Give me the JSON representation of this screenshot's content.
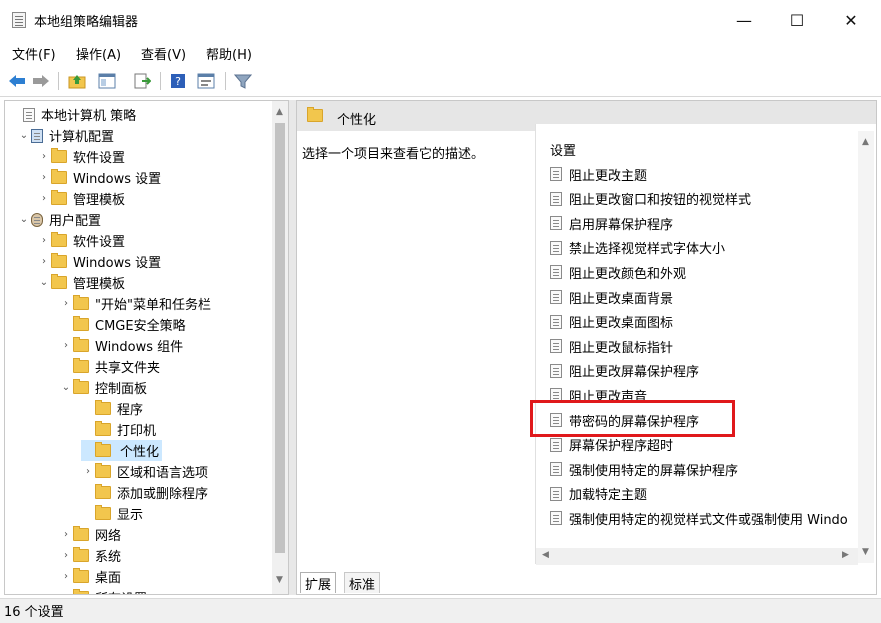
{
  "window": {
    "title": "本地组策略编辑器",
    "minimize": "—",
    "maximize": "☐",
    "close": "✕"
  },
  "menu": [
    "文件(F)",
    "操作(A)",
    "查看(V)",
    "帮助(H)"
  ],
  "toolbar": {
    "back": "back-arrow-icon",
    "forward": "forward-arrow-icon",
    "up": "up-folder-icon",
    "show_hide": "show-hide-tree-icon",
    "export": "export-list-icon",
    "help": "help-icon",
    "properties": "properties-icon",
    "filter": "filter-icon"
  },
  "tree": [
    {
      "label": "本地计算机 策略",
      "level": 0,
      "caret": "",
      "icon": "policy-doc-icon"
    },
    {
      "label": "计算机配置",
      "level": 1,
      "caret": "⌄",
      "icon": "computer-icon"
    },
    {
      "label": "软件设置",
      "level": 2,
      "caret": "›",
      "icon": "folder-icon"
    },
    {
      "label": "Windows 设置",
      "level": 2,
      "caret": "›",
      "icon": "folder-icon"
    },
    {
      "label": "管理模板",
      "level": 2,
      "caret": "›",
      "icon": "folder-icon"
    },
    {
      "label": "用户配置",
      "level": 1,
      "caret": "⌄",
      "icon": "user-icon"
    },
    {
      "label": "软件设置",
      "level": 2,
      "caret": "›",
      "icon": "folder-icon"
    },
    {
      "label": "Windows 设置",
      "level": 2,
      "caret": "›",
      "icon": "folder-icon"
    },
    {
      "label": "管理模板",
      "level": 2,
      "caret": "⌄",
      "icon": "folder-icon"
    },
    {
      "label": "\"开始\"菜单和任务栏",
      "level": 3,
      "caret": "›",
      "icon": "folder-icon"
    },
    {
      "label": "CMGE安全策略",
      "level": 3,
      "caret": "",
      "icon": "folder-icon"
    },
    {
      "label": "Windows 组件",
      "level": 3,
      "caret": "›",
      "icon": "folder-icon"
    },
    {
      "label": "共享文件夹",
      "level": 3,
      "caret": "",
      "icon": "folder-icon"
    },
    {
      "label": "控制面板",
      "level": 3,
      "caret": "⌄",
      "icon": "folder-icon"
    },
    {
      "label": "程序",
      "level": 4,
      "caret": "",
      "icon": "folder-icon"
    },
    {
      "label": "打印机",
      "level": 4,
      "caret": "",
      "icon": "folder-icon"
    },
    {
      "label": "个性化",
      "level": 4,
      "caret": "",
      "icon": "folder-icon",
      "selected": true
    },
    {
      "label": "区域和语言选项",
      "level": 4,
      "caret": "›",
      "icon": "folder-icon"
    },
    {
      "label": "添加或删除程序",
      "level": 4,
      "caret": "",
      "icon": "folder-icon"
    },
    {
      "label": "显示",
      "level": 4,
      "caret": "",
      "icon": "folder-icon"
    },
    {
      "label": "网络",
      "level": 3,
      "caret": "›",
      "icon": "folder-icon"
    },
    {
      "label": "系统",
      "level": 3,
      "caret": "›",
      "icon": "folder-icon"
    },
    {
      "label": "桌面",
      "level": 3,
      "caret": "›",
      "icon": "folder-icon"
    },
    {
      "label": "所有设置",
      "level": 3,
      "caret": "",
      "icon": "folder-icon"
    }
  ],
  "right": {
    "header": "个性化",
    "description": "选择一个项目来查看它的描述。",
    "column": "设置",
    "settings": [
      "阻止更改主题",
      "阻止更改窗口和按钮的视觉样式",
      "启用屏幕保护程序",
      "禁止选择视觉样式字体大小",
      "阻止更改颜色和外观",
      "阻止更改桌面背景",
      "阻止更改桌面图标",
      "阻止更改鼠标指针",
      "阻止更改屏幕保护程序",
      "阻止更改声音",
      "带密码的屏幕保护程序",
      "屏幕保护程序超时",
      "强制使用特定的屏幕保护程序",
      "加载特定主题",
      "强制使用特定的视觉样式文件或强制使用 Windo"
    ],
    "highlighted": "带密码的屏幕保护程序"
  },
  "tabs": [
    "扩展",
    "标准"
  ],
  "status": "16 个设置",
  "colors": {
    "selection": "#cce8ff",
    "highlight_box": "#e0181b",
    "folder": "#f2c64d"
  }
}
